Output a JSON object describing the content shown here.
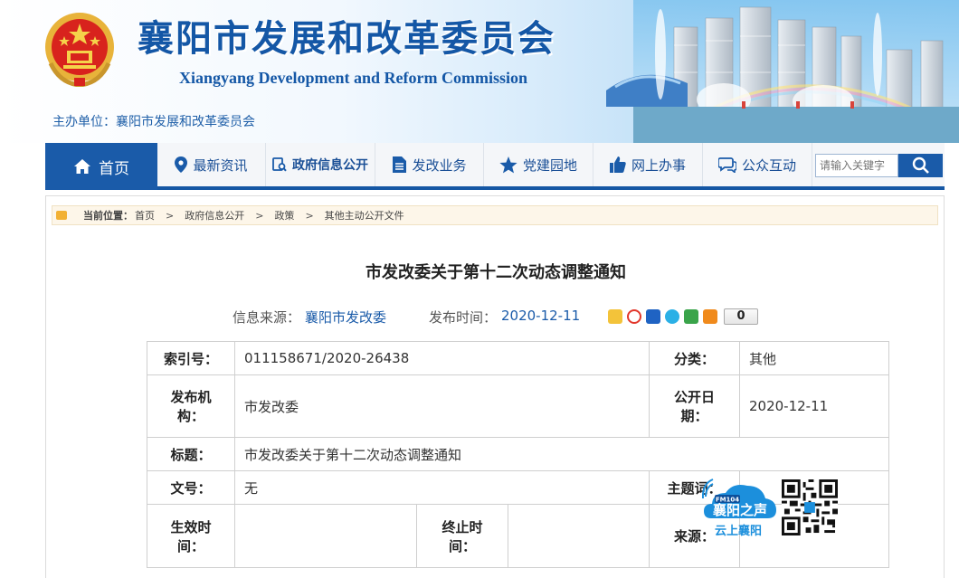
{
  "header": {
    "title": "襄阳市发展和改革委员会",
    "subtitle": "Xiangyang  Development and Reform Commission",
    "host": "主办单位：襄阳市发展和改革委员会"
  },
  "nav": {
    "home": "首页",
    "items": [
      "最新资讯",
      "政府信息公开",
      "发改业务",
      "党建园地",
      "网上办事",
      "公众互动"
    ],
    "search_placeholder": "请输入关键字"
  },
  "breadcrumb": {
    "label": "当前位置：",
    "items": [
      "首页",
      "政府信息公开",
      "政策",
      "其他主动公开文件"
    ],
    "sep": ">"
  },
  "article": {
    "title": "市发改委关于第十二次动态调整通知",
    "source_label": "信息来源：",
    "source": "襄阳市发改委",
    "date_label": "发布时间：",
    "date": "2020-12-11",
    "share_count": "0"
  },
  "info": {
    "index_label": "索引号：",
    "index": "011158671/2020-26438",
    "category_label": "分类：",
    "category": "其他",
    "org_label_1": "发布机",
    "org_label_2": "构：",
    "org": "市发改委",
    "open_label_1": "公开日",
    "open_label_2": "期：",
    "open_date": "2020-12-11",
    "title_label": "标题：",
    "title": "市发改委关于第十二次动态调整通知",
    "doc_label": "文号：",
    "doc": "无",
    "keyword_label": "主题词：",
    "eff_label_1": "生效时",
    "eff_label_2": "间：",
    "end_label_1": "终止时",
    "end_label_2": "间：",
    "from_label": "来源："
  },
  "widgets": {
    "radio_badge": "FM104",
    "radio_name": "襄阳之声",
    "radio_slogan": "云上襄阳"
  },
  "colors": {
    "brand": "#1a5ba9",
    "nav_text": "#1a4f96",
    "link": "#1a5ba9"
  }
}
